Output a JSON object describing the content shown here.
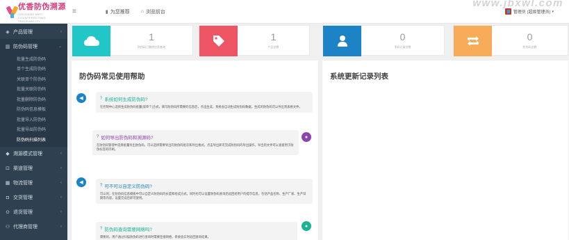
{
  "logo": {
    "title": "优香防伪溯源",
    "subtitle": "YOUXIANG ANTI-COUNTERFEITING TRACEABILITY"
  },
  "sidebar": {
    "items": [
      {
        "label": "产品管理",
        "icon": "cube-icon"
      },
      {
        "label": "防伪码管理",
        "icon": "barcode-icon"
      },
      {
        "label": "溯源模式管理",
        "icon": "tag-icon"
      },
      {
        "label": "渠道管理",
        "icon": "network-icon"
      },
      {
        "label": "物流管理",
        "icon": "table-icon"
      },
      {
        "label": "交货管理",
        "icon": "truck-icon"
      },
      {
        "label": "退货管理",
        "icon": "return-icon"
      },
      {
        "label": "代理商管理",
        "icon": "users-icon"
      }
    ],
    "sub_items": [
      "批量生成防伪码",
      "单个生成防伪码",
      "关联单个防伪码",
      "批量关联防伪码",
      "批量删除防伪码",
      "防伪码信息模板",
      "批量导入防伪码",
      "批量导出防伪码",
      "防伪码扫描列表"
    ],
    "current_sub": "防伪码扫描列表"
  },
  "topbar": {
    "menu_icon": "menu-icon",
    "links": [
      {
        "label": "为您推荐",
        "icon": "chart-icon"
      },
      {
        "label": "浏览前台",
        "icon": "home-icon"
      }
    ],
    "user": "管理员 (超级管理员)"
  },
  "watermark": "www.jbxwl.com",
  "stats": [
    {
      "value": "1",
      "label": "防伪码已删除信息查询",
      "color": "#23c6c8",
      "icon": "cloud-icon"
    },
    {
      "value": "1",
      "label": "产品总数",
      "color": "#ed5565",
      "icon": "tag-icon"
    },
    {
      "value": "0",
      "label": "发码记录总数",
      "color": "#1c84c6",
      "icon": "user-icon"
    },
    {
      "value": "0",
      "label": "防伪码总数",
      "color": "#f8ac59",
      "icon": "retweet-icon"
    }
  ],
  "help": {
    "title": "防伪码常见使用帮助",
    "messages": [
      {
        "q": "系统如何生成防伪码?",
        "color": "#1ab394",
        "a": "在控制中心选择生成防伪码批量(或单个)方式，填写防伪码所需要的信息后，点击生成，系统会自动生成防伪码数据，生成的防伪码可以导出到表格文件。"
      },
      {
        "q": "如何导出防伪码和溯源码?",
        "color": "#8e44ad",
        "a": "在防伪码管理中选择批量导出防伪码，可以选择需要导出的防伪码批次和导出格式，点击导出即可完成防伪码的导出操作，导出的文件可以直接用于防伪标签的印刷。"
      },
      {
        "q": "可不可以自定义防伪码?",
        "color": "#1c84c6",
        "a": "可以的，在防伪码信息模板中可以自定义防伪码的长度和组成方式，同时也可以设置防伪码查询后返回给用户的提示信息，包括产品名称、生产厂家、生产日期等内容，设置完成后即可使用。"
      },
      {
        "q": "防伪码查询需要网络吗?",
        "color": "#1ab394",
        "a": "需要的，用户通过扫描防伪码进行查询时需要连接网络，系统会实时返回查询结果。"
      }
    ]
  },
  "changelog": {
    "title": "系统更新记录列表"
  }
}
